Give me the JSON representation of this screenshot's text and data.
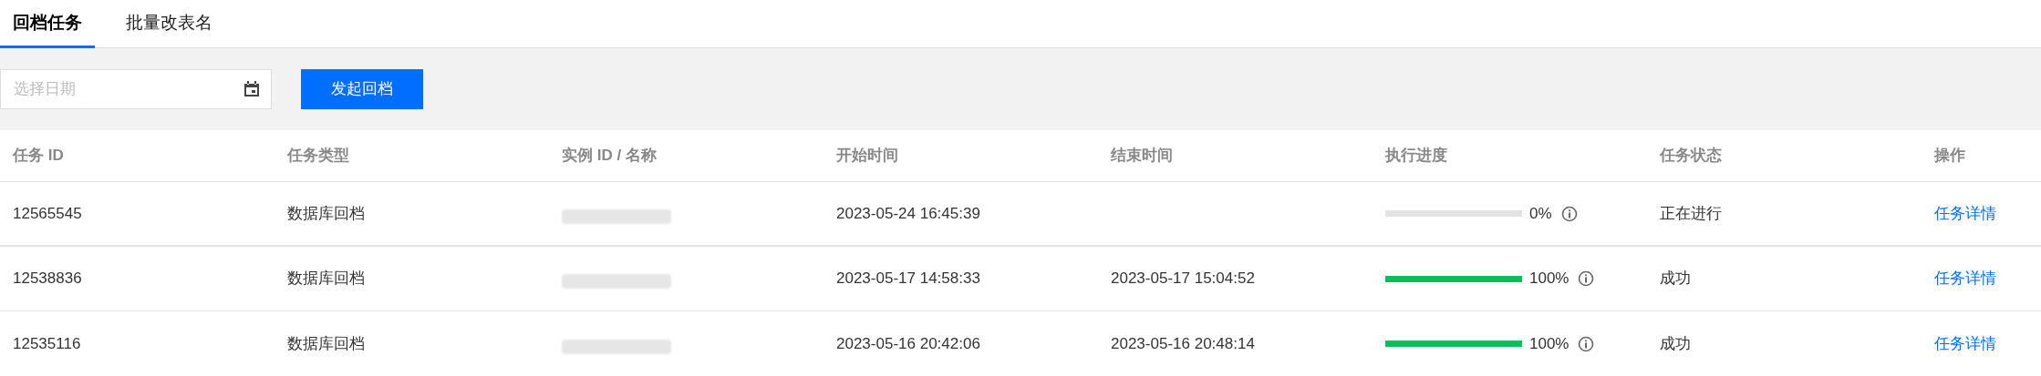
{
  "tabs": [
    {
      "label": "回档任务",
      "selected": true
    },
    {
      "label": "批量改表名",
      "selected": false
    }
  ],
  "toolbar": {
    "date_field": {
      "placeholder": "选择日期"
    },
    "start_button": "发起回档"
  },
  "table": {
    "columns": [
      "任务 ID",
      "任务类型",
      "实例 ID / 名称",
      "开始时间",
      "结束时间",
      "执行进度",
      "任务状态",
      "操作"
    ],
    "rows": [
      {
        "task_id": "12565545",
        "task_type": "数据库回档",
        "start_time": "2023-05-24 16:45:39",
        "end_time": "",
        "progress": {
          "level": 0,
          "reading": "0%"
        },
        "status": "正在进行",
        "action": "任务详情"
      },
      {
        "task_id": "12538836",
        "task_type": "数据库回档",
        "start_time": "2023-05-17 14:58:33",
        "end_time": "2023-05-17 15:04:52",
        "progress": {
          "level": 1,
          "reading": "100%"
        },
        "status": "成功",
        "action": "任务详情"
      },
      {
        "task_id": "12535116",
        "task_type": "数据库回档",
        "start_time": "2023-05-16 20:42:06",
        "end_time": "2023-05-16 20:48:14",
        "progress": {
          "level": 1,
          "reading": "100%"
        },
        "status": "成功",
        "action": "任务详情"
      }
    ]
  }
}
